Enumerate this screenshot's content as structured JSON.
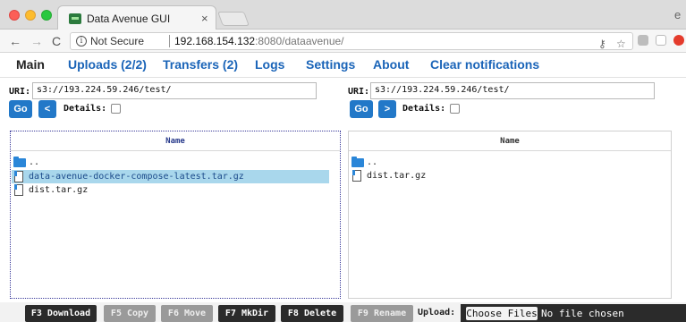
{
  "browser": {
    "tab_title": "Data Avenue GUI",
    "tab_close": "×",
    "url_security": "Not Secure",
    "url_host": "192.168.154.132",
    "url_rest": ":8080/dataavenue/",
    "back_glyph": "←",
    "forward_glyph": "→",
    "reload_glyph": "C",
    "info_glyph": "i",
    "key_glyph": "⚷",
    "star_glyph": "☆",
    "profile_glyph": "e"
  },
  "menu": {
    "main": "Main",
    "uploads": "Uploads (2/2)",
    "transfers": "Transfers (2)",
    "logs": "Logs",
    "settings": "Settings",
    "about": "About",
    "clear": "Clear notifications"
  },
  "left_panel": {
    "uri_label": "URI:",
    "uri_value": "s3://193.224.59.246/test/",
    "go_label": "Go",
    "nav_label": "<",
    "details_label": "Details:",
    "header_name": "Name",
    "rows": [
      {
        "name": "..",
        "type": "folder"
      },
      {
        "name": "data-avenue-docker-compose-latest.tar.gz",
        "type": "file",
        "selected": true
      },
      {
        "name": "dist.tar.gz",
        "type": "file"
      }
    ]
  },
  "right_panel": {
    "uri_label": "URI:",
    "uri_value": "s3://193.224.59.246/test/",
    "go_label": "Go",
    "nav_label": ">",
    "details_label": "Details:",
    "header_name": "Name",
    "rows": [
      {
        "name": "..",
        "type": "folder"
      },
      {
        "name": "dist.tar.gz",
        "type": "file"
      }
    ]
  },
  "toolbar": {
    "download": "F3 Download",
    "copy": "F5 Copy",
    "move": "F6 Move",
    "mkdir": "F7 MkDir",
    "delete": "F8 Delete",
    "rename": "F9 Rename",
    "upload_label": "Upload:",
    "choose_files": "Choose Files",
    "no_file": "No file chosen"
  },
  "colors": {
    "link_blue": "#1a64b8",
    "button_blue": "#2278c8",
    "selected_row": "#a9d7ec",
    "toolbar_dark": "#2b2b2b",
    "toolbar_disabled": "#9a9a9a"
  }
}
